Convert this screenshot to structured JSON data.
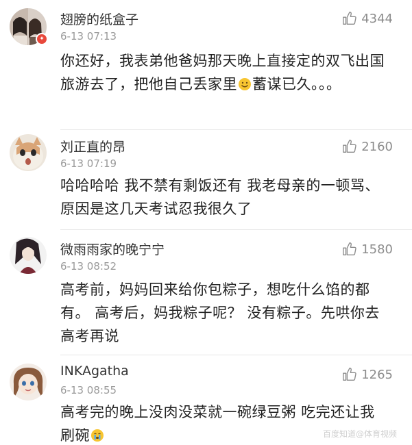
{
  "comments": [
    {
      "username": "翅膀的纸盒子",
      "time": "6-13 07:13",
      "likes": "4344",
      "text_before_emoji": "你还好，我表弟他爸妈那天晚上直接定的双飞出国旅游去了，把他自己丢家里",
      "emoji": "smile-emoji",
      "text_after_emoji": "蓄谋已久。。。"
    },
    {
      "username": "刘正直的昂",
      "time": "6-13 07:19",
      "likes": "2160",
      "text": "哈哈哈哈 我不禁有剩饭还有 我老母亲的一顿骂、原因是这几天考试忍我很久了"
    },
    {
      "username": "微雨雨家的晚宁宁",
      "time": "6-13 08:52",
      "likes": "1580",
      "text": "高考前，妈妈回来给你包粽子，想吃什么馅的都有。 高考后，妈我粽子呢？  没有粽子。先哄你去高考再说"
    },
    {
      "username": "INKAgatha",
      "time": "6-13 08:55",
      "likes": "1265",
      "text_before_emoji": "高考完的晚上没肉没菜就一碗绿豆粥 吃完还让我刷碗",
      "emoji": "crying-emoji",
      "text_after_emoji": ""
    }
  ],
  "watermark": "百度知道@体育视频"
}
